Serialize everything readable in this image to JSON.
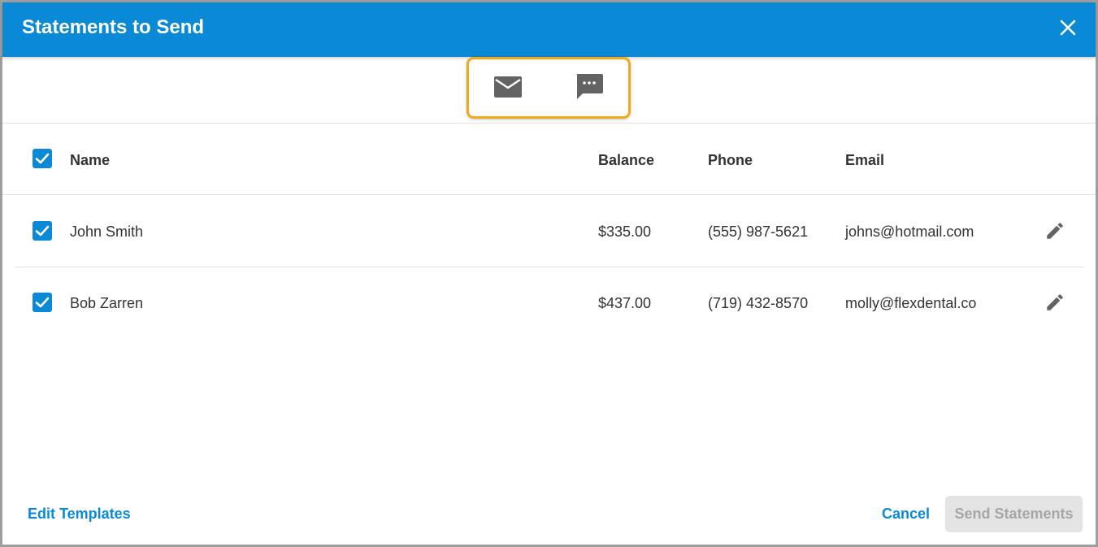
{
  "dialog": {
    "title": "Statements to Send"
  },
  "channels": [
    {
      "name": "email",
      "icon": "envelope-icon"
    },
    {
      "name": "sms",
      "icon": "chat-bubble-icon"
    }
  ],
  "table": {
    "columns": {
      "name": "Name",
      "balance": "Balance",
      "phone": "Phone",
      "email": "Email"
    },
    "rows": [
      {
        "name": "John Smith",
        "balance": "$335.00",
        "phone": "(555) 987-5621",
        "email": "johns@hotmail.com",
        "checked": true
      },
      {
        "name": "Bob Zarren",
        "balance": "$437.00",
        "phone": "(719) 432-8570",
        "email": "molly@flexdental.co",
        "checked": true
      }
    ]
  },
  "footer": {
    "edit_templates": "Edit Templates",
    "cancel": "Cancel",
    "send": "Send Statements"
  },
  "colors": {
    "header_bg": "#0a8ad6",
    "highlight": "#f2a81b",
    "icon_gray": "#636363",
    "disabled_bg": "#e4e4e4",
    "disabled_text": "#a6a6a6"
  }
}
